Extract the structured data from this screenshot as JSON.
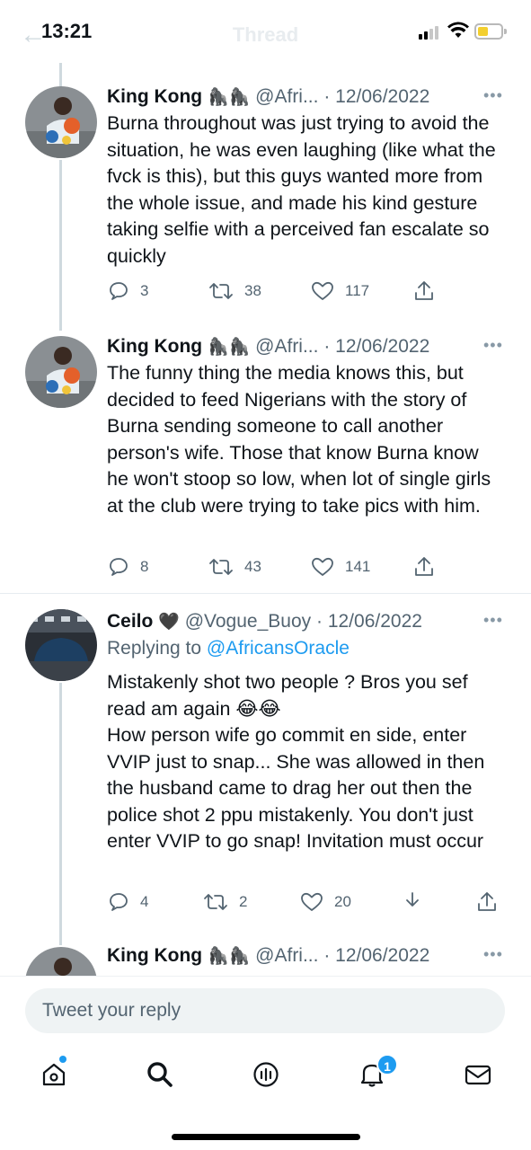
{
  "status_bar": {
    "time": "13:21",
    "faded_title": "Thread"
  },
  "tweets": [
    {
      "name": "King Kong",
      "emoji": "🦍🦍",
      "handle": "@Afri...",
      "date": "12/06/2022",
      "separator": "·",
      "body": "Burna throughout was just trying to avoid the situation, he was even laughing (like what the fvck is this), but this guys wanted more from the whole issue, and made his kind gesture taking selfie with a perceived fan escalate so quickly",
      "replies": "3",
      "retweets": "38",
      "likes": "117"
    },
    {
      "name": "King Kong",
      "emoji": "🦍🦍",
      "handle": "@Afri...",
      "date": "12/06/2022",
      "separator": "·",
      "body": "The funny thing the media knows this, but decided to feed Nigerians with the story of Burna sending someone to call another person's wife. Those that know Burna know he won't stoop so low, when lot of single girls at the club were trying to take pics with him.",
      "replies": "8",
      "retweets": "43",
      "likes": "141"
    },
    {
      "name": "Ceilo",
      "emoji": "🖤",
      "handle": "@Vogue_Buoy",
      "date": "12/06/2022",
      "separator": "·",
      "replying_prefix": "Replying to ",
      "replying_to": "@AfricansOracle",
      "body_line1": "Mistakenly shot two people ? Bros you sef read am again 😂😂",
      "body_line2": "How person wife go commit en side, enter VVIP just to snap... She was allowed in then the husband came to drag her out then the police shot 2 ppu mistakenly. You don't just enter VVIP to go snap! Invitation must occur",
      "replies": "4",
      "retweets": "2",
      "likes": "20"
    },
    {
      "name": "King Kong",
      "emoji": "🦍🦍",
      "handle": "@Afri...",
      "date": "12/06/2022",
      "separator": "·"
    }
  ],
  "composer": {
    "placeholder": "Tweet your reply"
  },
  "tabbar": {
    "notifications_badge": "1"
  },
  "icons": {
    "reply": "reply-icon",
    "retweet": "retweet-icon",
    "like": "heart-icon",
    "share": "share-icon",
    "download": "download-icon",
    "more": "more-icon",
    "home": "home-icon",
    "search": "search-icon",
    "spaces": "spaces-icon",
    "notifications": "bell-icon",
    "messages": "envelope-icon"
  },
  "colors": {
    "accent": "#1d9bf0",
    "text": "#0f1419",
    "muted": "#536471",
    "line": "#cfd9de"
  }
}
